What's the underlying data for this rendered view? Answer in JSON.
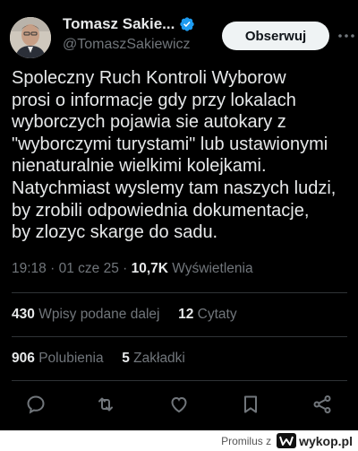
{
  "author": {
    "display_name": "Tomasz Sakie...",
    "handle": "@TomaszSakiewicz",
    "verified": true
  },
  "follow_button": {
    "label": "Obserwuj"
  },
  "tweet": {
    "lines": [
      "Spoleczny Ruch Kontroli  Wyborow",
      "prosi o  informacje gdy przy lokalach",
      "wyborczych pojawia sie autokary z",
      "\"wyborczymi turystami\" lub ustawionymi",
      "nienaturalnie wielkimi kolejkami.",
      "Natychmiast wyslemy tam naszych ludzi,",
      "by zrobili odpowiednia dokumentacje,",
      "by zlozyc skarge do sadu."
    ],
    "time": "19:18",
    "date": "01 cze 25",
    "separator": "·",
    "views_count": "10,7K",
    "views_label": "Wyświetlenia"
  },
  "stats": {
    "reposts_count": "430",
    "reposts_label": "Wpisy podane dalej",
    "quotes_count": "12",
    "quotes_label": "Cytaty",
    "likes_count": "906",
    "likes_label": "Polubienia",
    "bookmarks_count": "5",
    "bookmarks_label": "Zakładki"
  },
  "actions": [
    "reply-icon",
    "repost-icon",
    "like-icon",
    "bookmark-icon",
    "share-icon"
  ],
  "footer": {
    "user": "Promilus",
    "connector": "z",
    "site": "wykop.pl"
  },
  "colors": {
    "background": "#000000",
    "text": "#e7e9ea",
    "secondary": "#71767b",
    "verified": "#1d9bf0",
    "divider": "#2f3336"
  }
}
